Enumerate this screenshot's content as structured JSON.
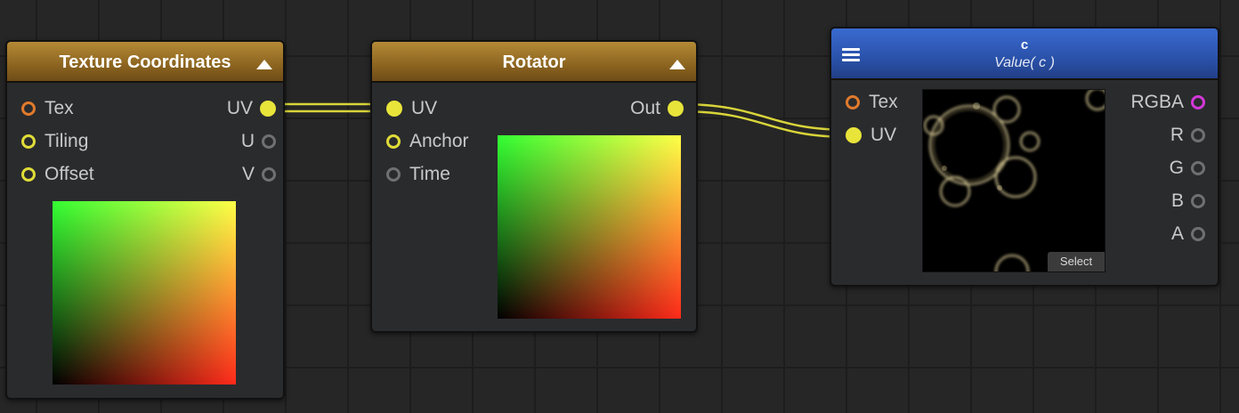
{
  "nodes": {
    "texcoord": {
      "title": "Texture Coordinates",
      "inputs": [
        "Tex",
        "Tiling",
        "Offset"
      ],
      "outputs": [
        "UV",
        "U",
        "V"
      ]
    },
    "rotator": {
      "title": "Rotator",
      "inputs": [
        "UV",
        "Anchor",
        "Time"
      ],
      "outputs": [
        "Out"
      ]
    },
    "sampler": {
      "title": "c",
      "subtitle": "Value( c )",
      "inputs": [
        "Tex",
        "UV"
      ],
      "outputs": [
        "RGBA",
        "R",
        "G",
        "B",
        "A"
      ],
      "select_label": "Select"
    }
  },
  "colors": {
    "canvas": "#262626",
    "node_header_orange": "#8c6420",
    "node_header_blue": "#2a52aa",
    "wire": "#e8e43a",
    "port_yellow": "#e8e43a",
    "port_orange": "#e07a2c",
    "port_gray": "#707070",
    "port_magenta": "#d338d8"
  },
  "icons": [
    "collapse-triangle-icon",
    "hamburger-menu-icon"
  ]
}
